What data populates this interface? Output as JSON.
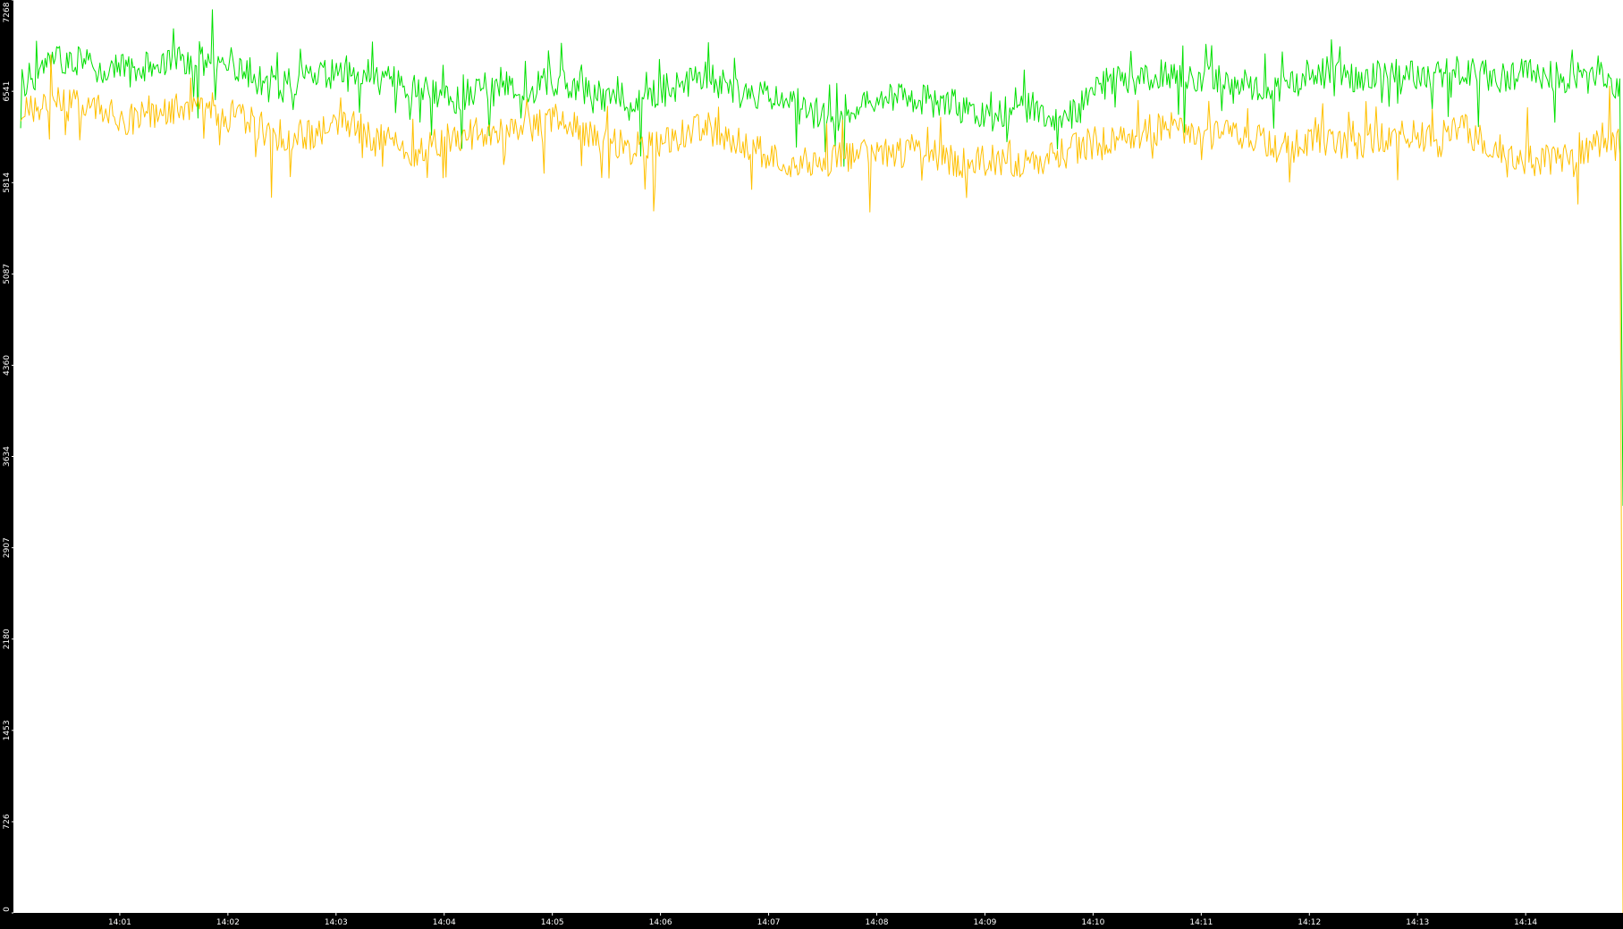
{
  "chart_data": {
    "type": "line",
    "title": "",
    "xlabel": "",
    "ylabel": "",
    "x_ticks": [
      "14:01",
      "14:02",
      "14:03",
      "14:04",
      "14:05",
      "14:06",
      "14:07",
      "14:08",
      "14:09",
      "14:10",
      "14:11",
      "14:12",
      "14:13",
      "14:14"
    ],
    "y_ticks": [
      "0",
      "726",
      "1453",
      "2180",
      "2907",
      "3634",
      "4360",
      "5087",
      "5814",
      "6541",
      "7268"
    ],
    "ylim": [
      0,
      7268
    ],
    "xlim": [
      "14:00:01",
      "14:14:54"
    ],
    "grid": false,
    "legend": "none",
    "series": [
      {
        "color": "#00e000",
        "style": "dense noisy line",
        "x": [
          "14:00:05",
          "14:00:25",
          "14:00:45",
          "14:01:05",
          "14:01:25",
          "14:01:45",
          "14:02:05",
          "14:02:25",
          "14:02:45",
          "14:03:05",
          "14:03:25",
          "14:03:45",
          "14:04:05",
          "14:04:25",
          "14:04:45",
          "14:05:05",
          "14:05:25",
          "14:05:45",
          "14:06:05",
          "14:06:25",
          "14:06:45",
          "14:07:05",
          "14:07:25",
          "14:07:45",
          "14:08:05",
          "14:08:25",
          "14:08:45",
          "14:09:05",
          "14:09:25",
          "14:09:45",
          "14:10:05",
          "14:10:25",
          "14:10:45",
          "14:11:05",
          "14:11:25",
          "14:11:45",
          "14:12:05",
          "14:12:25",
          "14:12:45",
          "14:13:05",
          "14:13:25",
          "14:13:45",
          "14:14:05",
          "14:14:25",
          "14:14:45",
          "14:14:53",
          "14:14:54"
        ],
        "values": [
          6600,
          6800,
          6750,
          6700,
          6780,
          6820,
          6750,
          6560,
          6640,
          6720,
          6640,
          6560,
          6480,
          6600,
          6560,
          6640,
          6520,
          6470,
          6560,
          6650,
          6520,
          6480,
          6360,
          6420,
          6500,
          6480,
          6420,
          6350,
          6430,
          6300,
          6600,
          6640,
          6700,
          6650,
          6600,
          6580,
          6700,
          6660,
          6700,
          6640,
          6720,
          6640,
          6700,
          6640,
          6660,
          6540,
          3240
        ]
      },
      {
        "color": "#ffc000",
        "style": "dense noisy line",
        "x": [
          "14:00:05",
          "14:00:25",
          "14:00:45",
          "14:01:05",
          "14:01:25",
          "14:01:45",
          "14:02:05",
          "14:02:25",
          "14:02:45",
          "14:03:05",
          "14:03:25",
          "14:03:45",
          "14:04:05",
          "14:04:25",
          "14:04:45",
          "14:05:05",
          "14:05:25",
          "14:05:45",
          "14:06:05",
          "14:06:25",
          "14:06:45",
          "14:07:05",
          "14:07:25",
          "14:07:45",
          "14:08:05",
          "14:08:25",
          "14:08:45",
          "14:09:05",
          "14:09:25",
          "14:09:45",
          "14:10:05",
          "14:10:25",
          "14:10:45",
          "14:11:05",
          "14:11:25",
          "14:11:45",
          "14:12:05",
          "14:12:25",
          "14:12:45",
          "14:13:05",
          "14:13:25",
          "14:13:45",
          "14:14:05",
          "14:14:25",
          "14:14:45",
          "14:14:53",
          "14:14:54"
        ],
        "values": [
          6350,
          6450,
          6400,
          6320,
          6380,
          6420,
          6360,
          6200,
          6180,
          6300,
          6160,
          6060,
          6180,
          6220,
          6260,
          6320,
          6160,
          6080,
          6150,
          6260,
          6120,
          6000,
          5960,
          6020,
          6040,
          6080,
          5960,
          6000,
          5980,
          6060,
          6150,
          6200,
          6260,
          6200,
          6180,
          6080,
          6160,
          6120,
          6200,
          6180,
          6240,
          6100,
          5980,
          6020,
          6180,
          6080,
          0
        ]
      }
    ]
  }
}
